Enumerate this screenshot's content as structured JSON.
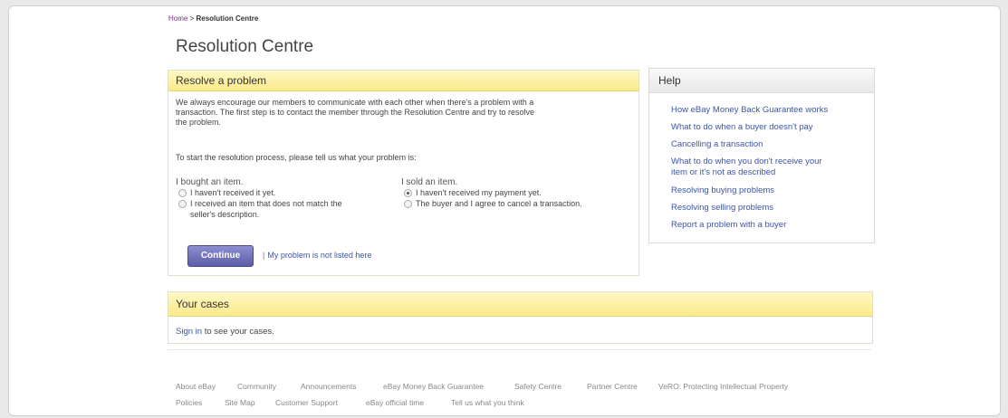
{
  "breadcrumb": {
    "home": "Home",
    "separator": " > ",
    "current": "Resolution Centre"
  },
  "page_title": "Resolution Centre",
  "resolve": {
    "heading": "Resolve a problem",
    "intro_line1": "We always encourage our members to communicate with each other when there's a problem with a",
    "intro_line2": "transaction. The first step is to contact the member through the Resolution Centre and try to resolve",
    "intro_line3": "the problem.",
    "prompt": "To start the resolution process, please tell us what your problem is:",
    "bought": {
      "heading": "I bought an item.",
      "options": [
        "I haven't received it yet.",
        "I received an item that does not match the",
        "seller's description."
      ]
    },
    "sold": {
      "heading": "I sold an item.",
      "options": [
        "I haven't received my payment yet.",
        "The buyer and I agree to cancel a transaction."
      ],
      "selected": "I haven't received my payment yet."
    },
    "continue_label": "Continue",
    "separator": "|",
    "not_listed_link": "My problem is not listed here"
  },
  "help": {
    "heading": "Help",
    "links": [
      "How eBay Money Back Guarantee works",
      "What to do when a buyer doesn't pay",
      "Cancelling a transaction",
      "What to do when you don't receive your",
      "item or it's not as described",
      "Resolving buying problems",
      "Resolving selling problems",
      "Report a problem with a buyer"
    ]
  },
  "cases": {
    "heading": "Your cases",
    "sign_in_link": "Sign in",
    "sign_in_text": " to see your cases."
  },
  "footer": {
    "row1": [
      "About eBay",
      "Community",
      "Announcements",
      "eBay Money Back Guarantee",
      "Safety Centre",
      "Partner Centre",
      "VeRO: Protecting Intellectual Property"
    ],
    "row2": [
      "Policies",
      "Site Map",
      "Customer Support",
      "eBay official time",
      "Tell us what you think"
    ]
  },
  "colors": {
    "accent_link": "#3b55a5",
    "header_yellow": "#fbe98a",
    "button_purple": "#5b5ca7"
  }
}
